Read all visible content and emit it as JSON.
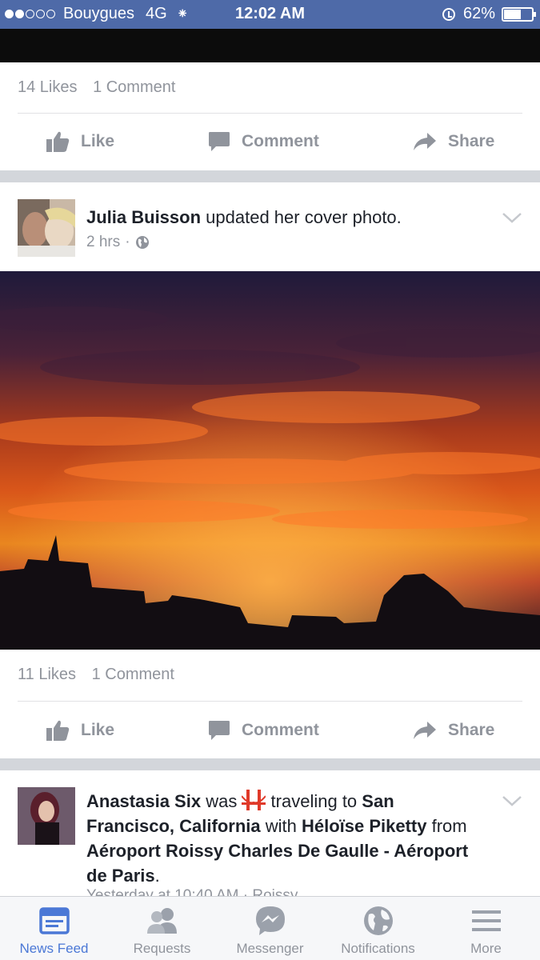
{
  "status_bar": {
    "carrier": "Bouygues",
    "network": "4G",
    "time": "12:02 AM",
    "battery": "62%",
    "battery_level": 0.62,
    "signal_bars_filled": 2,
    "signal_bars_total": 5
  },
  "post1": {
    "likes": "14 Likes",
    "comments": "1 Comment"
  },
  "post2": {
    "author": "Julia Buisson",
    "action": " updated her cover photo.",
    "time": "2 hrs",
    "likes": "11 Likes",
    "comments": "1 Comment"
  },
  "post3": {
    "author": "Anastasia Six",
    "was": " was ",
    "activity": " traveling to ",
    "destination": "San Francisco, California",
    "with_text": " with ",
    "companion": "Héloïse Piketty",
    "from_text": " from ",
    "origin": "Aéroport Roissy Charles De Gaulle - Aéroport de Paris",
    "period": ".",
    "time_partial": "Yesterday at 10:40 AM · Roissy..."
  },
  "actions": {
    "like": "Like",
    "comment": "Comment",
    "share": "Share"
  },
  "tabbar": {
    "news_feed": "News Feed",
    "requests": "Requests",
    "messenger": "Messenger",
    "notifications": "Notifications",
    "more": "More"
  },
  "colors": {
    "brand_blue": "#4e6aa8",
    "active_tab": "#4b78d6",
    "muted_text": "#90949c"
  }
}
